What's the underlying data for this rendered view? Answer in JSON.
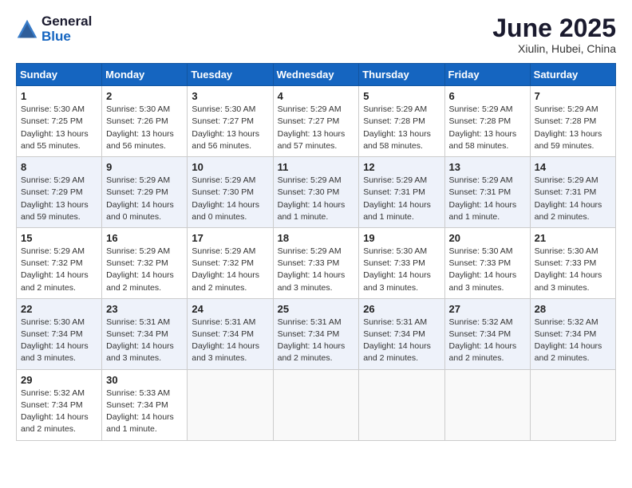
{
  "header": {
    "logo_general": "General",
    "logo_blue": "Blue",
    "month_title": "June 2025",
    "location": "Xiulin, Hubei, China"
  },
  "days_of_week": [
    "Sunday",
    "Monday",
    "Tuesday",
    "Wednesday",
    "Thursday",
    "Friday",
    "Saturday"
  ],
  "weeks": [
    [
      {
        "day": "1",
        "sunrise": "Sunrise: 5:30 AM",
        "sunset": "Sunset: 7:25 PM",
        "daylight": "Daylight: 13 hours and 55 minutes."
      },
      {
        "day": "2",
        "sunrise": "Sunrise: 5:30 AM",
        "sunset": "Sunset: 7:26 PM",
        "daylight": "Daylight: 13 hours and 56 minutes."
      },
      {
        "day": "3",
        "sunrise": "Sunrise: 5:30 AM",
        "sunset": "Sunset: 7:27 PM",
        "daylight": "Daylight: 13 hours and 56 minutes."
      },
      {
        "day": "4",
        "sunrise": "Sunrise: 5:29 AM",
        "sunset": "Sunset: 7:27 PM",
        "daylight": "Daylight: 13 hours and 57 minutes."
      },
      {
        "day": "5",
        "sunrise": "Sunrise: 5:29 AM",
        "sunset": "Sunset: 7:28 PM",
        "daylight": "Daylight: 13 hours and 58 minutes."
      },
      {
        "day": "6",
        "sunrise": "Sunrise: 5:29 AM",
        "sunset": "Sunset: 7:28 PM",
        "daylight": "Daylight: 13 hours and 58 minutes."
      },
      {
        "day": "7",
        "sunrise": "Sunrise: 5:29 AM",
        "sunset": "Sunset: 7:28 PM",
        "daylight": "Daylight: 13 hours and 59 minutes."
      }
    ],
    [
      {
        "day": "8",
        "sunrise": "Sunrise: 5:29 AM",
        "sunset": "Sunset: 7:29 PM",
        "daylight": "Daylight: 13 hours and 59 minutes."
      },
      {
        "day": "9",
        "sunrise": "Sunrise: 5:29 AM",
        "sunset": "Sunset: 7:29 PM",
        "daylight": "Daylight: 14 hours and 0 minutes."
      },
      {
        "day": "10",
        "sunrise": "Sunrise: 5:29 AM",
        "sunset": "Sunset: 7:30 PM",
        "daylight": "Daylight: 14 hours and 0 minutes."
      },
      {
        "day": "11",
        "sunrise": "Sunrise: 5:29 AM",
        "sunset": "Sunset: 7:30 PM",
        "daylight": "Daylight: 14 hours and 1 minute."
      },
      {
        "day": "12",
        "sunrise": "Sunrise: 5:29 AM",
        "sunset": "Sunset: 7:31 PM",
        "daylight": "Daylight: 14 hours and 1 minute."
      },
      {
        "day": "13",
        "sunrise": "Sunrise: 5:29 AM",
        "sunset": "Sunset: 7:31 PM",
        "daylight": "Daylight: 14 hours and 1 minute."
      },
      {
        "day": "14",
        "sunrise": "Sunrise: 5:29 AM",
        "sunset": "Sunset: 7:31 PM",
        "daylight": "Daylight: 14 hours and 2 minutes."
      }
    ],
    [
      {
        "day": "15",
        "sunrise": "Sunrise: 5:29 AM",
        "sunset": "Sunset: 7:32 PM",
        "daylight": "Daylight: 14 hours and 2 minutes."
      },
      {
        "day": "16",
        "sunrise": "Sunrise: 5:29 AM",
        "sunset": "Sunset: 7:32 PM",
        "daylight": "Daylight: 14 hours and 2 minutes."
      },
      {
        "day": "17",
        "sunrise": "Sunrise: 5:29 AM",
        "sunset": "Sunset: 7:32 PM",
        "daylight": "Daylight: 14 hours and 2 minutes."
      },
      {
        "day": "18",
        "sunrise": "Sunrise: 5:29 AM",
        "sunset": "Sunset: 7:33 PM",
        "daylight": "Daylight: 14 hours and 3 minutes."
      },
      {
        "day": "19",
        "sunrise": "Sunrise: 5:30 AM",
        "sunset": "Sunset: 7:33 PM",
        "daylight": "Daylight: 14 hours and 3 minutes."
      },
      {
        "day": "20",
        "sunrise": "Sunrise: 5:30 AM",
        "sunset": "Sunset: 7:33 PM",
        "daylight": "Daylight: 14 hours and 3 minutes."
      },
      {
        "day": "21",
        "sunrise": "Sunrise: 5:30 AM",
        "sunset": "Sunset: 7:33 PM",
        "daylight": "Daylight: 14 hours and 3 minutes."
      }
    ],
    [
      {
        "day": "22",
        "sunrise": "Sunrise: 5:30 AM",
        "sunset": "Sunset: 7:34 PM",
        "daylight": "Daylight: 14 hours and 3 minutes."
      },
      {
        "day": "23",
        "sunrise": "Sunrise: 5:31 AM",
        "sunset": "Sunset: 7:34 PM",
        "daylight": "Daylight: 14 hours and 3 minutes."
      },
      {
        "day": "24",
        "sunrise": "Sunrise: 5:31 AM",
        "sunset": "Sunset: 7:34 PM",
        "daylight": "Daylight: 14 hours and 3 minutes."
      },
      {
        "day": "25",
        "sunrise": "Sunrise: 5:31 AM",
        "sunset": "Sunset: 7:34 PM",
        "daylight": "Daylight: 14 hours and 2 minutes."
      },
      {
        "day": "26",
        "sunrise": "Sunrise: 5:31 AM",
        "sunset": "Sunset: 7:34 PM",
        "daylight": "Daylight: 14 hours and 2 minutes."
      },
      {
        "day": "27",
        "sunrise": "Sunrise: 5:32 AM",
        "sunset": "Sunset: 7:34 PM",
        "daylight": "Daylight: 14 hours and 2 minutes."
      },
      {
        "day": "28",
        "sunrise": "Sunrise: 5:32 AM",
        "sunset": "Sunset: 7:34 PM",
        "daylight": "Daylight: 14 hours and 2 minutes."
      }
    ],
    [
      {
        "day": "29",
        "sunrise": "Sunrise: 5:32 AM",
        "sunset": "Sunset: 7:34 PM",
        "daylight": "Daylight: 14 hours and 2 minutes."
      },
      {
        "day": "30",
        "sunrise": "Sunrise: 5:33 AM",
        "sunset": "Sunset: 7:34 PM",
        "daylight": "Daylight: 14 hours and 1 minute."
      },
      {
        "day": "",
        "sunrise": "",
        "sunset": "",
        "daylight": ""
      },
      {
        "day": "",
        "sunrise": "",
        "sunset": "",
        "daylight": ""
      },
      {
        "day": "",
        "sunrise": "",
        "sunset": "",
        "daylight": ""
      },
      {
        "day": "",
        "sunrise": "",
        "sunset": "",
        "daylight": ""
      },
      {
        "day": "",
        "sunrise": "",
        "sunset": "",
        "daylight": ""
      }
    ]
  ]
}
